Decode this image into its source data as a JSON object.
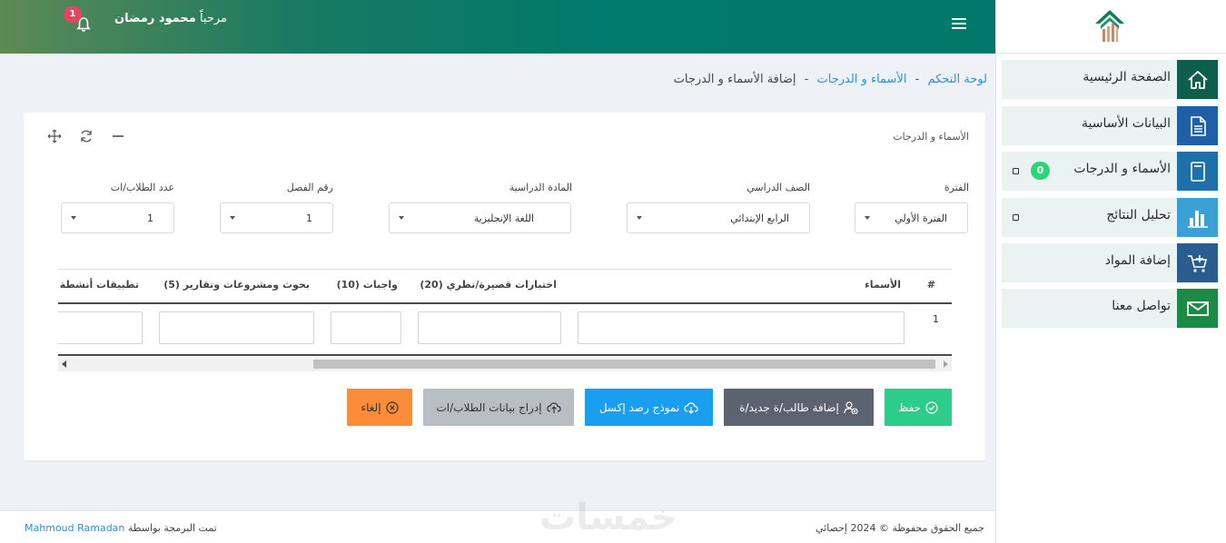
{
  "header": {
    "welcome_prefix": "مرحباً",
    "user_name": "محمود رمضان",
    "notification_count": "1"
  },
  "sidebar": {
    "items": [
      {
        "label": "الصفحة الرئيسية",
        "icon": "home-icon",
        "color": "#0e5e4e"
      },
      {
        "label": "البيانات الأساسية",
        "icon": "document-icon",
        "color": "#1f5fa6"
      },
      {
        "label": "الأسماء و الدرجات",
        "icon": "book-icon",
        "color": "#1f6fab",
        "count": "0"
      },
      {
        "label": "تحليل النتائج",
        "icon": "bar-chart-icon",
        "color": "#3aa0d5"
      },
      {
        "label": "إضافة المواد",
        "icon": "cart-add-icon",
        "color": "#2a5d8f"
      },
      {
        "label": "تواصل معنا",
        "icon": "mail-icon",
        "color": "#1a8a45"
      }
    ]
  },
  "breadcrumb": {
    "home": "لوحة التحكم",
    "section": "الأسماء و الدرجات",
    "current": "إضافة الأسماء و الدرجات",
    "separator": "-"
  },
  "card": {
    "title": "الأسماء و الدرجات"
  },
  "filters": {
    "period": {
      "label": "الفترة",
      "value": "الفترة الأولي"
    },
    "grade": {
      "label": "الصف الدراسي",
      "value": "الرابع الإبتدائي"
    },
    "subject": {
      "label": "المادة الدراسية",
      "value": "اللغة الإنجليزية"
    },
    "class_no": {
      "label": "رقم الفصل",
      "value": "1"
    },
    "student_count": {
      "label": "عدد الطلاب/ات",
      "value": "1"
    }
  },
  "table": {
    "headers": {
      "index": "#",
      "names": "الأسماء",
      "quizzes": "اختبارات قصيرة/نظري (20)",
      "homework": "واجبات (10)",
      "research": "بحوث ومشروعات وتقارير (5)",
      "activities": "تطبيقات أنشطة"
    },
    "rows": [
      {
        "index": "1"
      }
    ]
  },
  "buttons": {
    "save": "حفظ",
    "add_student": "إضافة طالب/ة جديد/ة",
    "excel_template": "نموذج رصد إكسل",
    "import_students": "إدراج بيانات الطلاب/ات",
    "cancel": "إلغاء"
  },
  "colors": {
    "save": "#2ecc8a",
    "add_student": "#5b6270",
    "excel_template": "#1a9ef0",
    "import_students": "#b9bdc4",
    "cancel": "#fb8c3a"
  },
  "footer": {
    "copyright": "جميع الحقوق محفوظة © 2024 إحصائي",
    "credit_prefix": "تمت البرمجة بواسطة",
    "credit_name": "Mahmoud Ramadan",
    "watermark": "خمسات"
  }
}
